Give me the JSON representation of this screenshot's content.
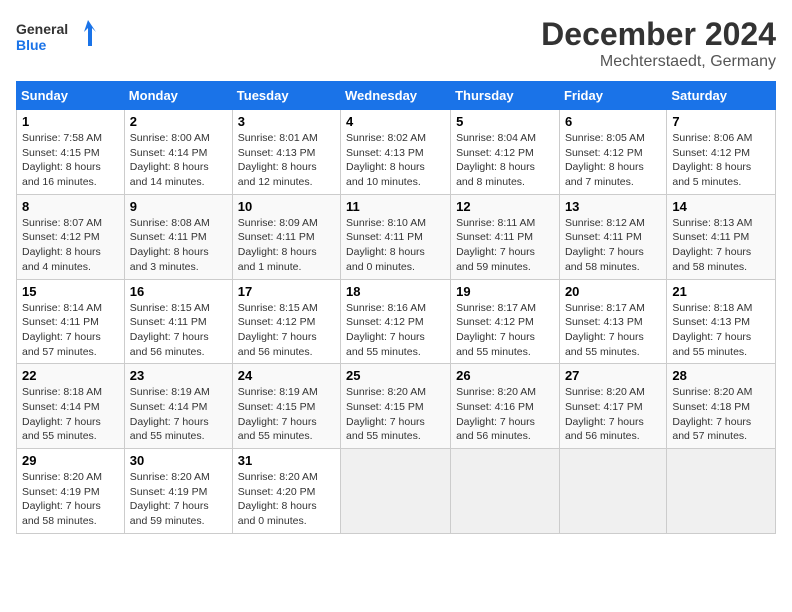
{
  "logo": {
    "general": "General",
    "blue": "Blue"
  },
  "title": "December 2024",
  "location": "Mechterstaedt, Germany",
  "days_of_week": [
    "Sunday",
    "Monday",
    "Tuesday",
    "Wednesday",
    "Thursday",
    "Friday",
    "Saturday"
  ],
  "weeks": [
    [
      {
        "day": "1",
        "sunrise": "Sunrise: 7:58 AM",
        "sunset": "Sunset: 4:15 PM",
        "daylight": "Daylight: 8 hours and 16 minutes."
      },
      {
        "day": "2",
        "sunrise": "Sunrise: 8:00 AM",
        "sunset": "Sunset: 4:14 PM",
        "daylight": "Daylight: 8 hours and 14 minutes."
      },
      {
        "day": "3",
        "sunrise": "Sunrise: 8:01 AM",
        "sunset": "Sunset: 4:13 PM",
        "daylight": "Daylight: 8 hours and 12 minutes."
      },
      {
        "day": "4",
        "sunrise": "Sunrise: 8:02 AM",
        "sunset": "Sunset: 4:13 PM",
        "daylight": "Daylight: 8 hours and 10 minutes."
      },
      {
        "day": "5",
        "sunrise": "Sunrise: 8:04 AM",
        "sunset": "Sunset: 4:12 PM",
        "daylight": "Daylight: 8 hours and 8 minutes."
      },
      {
        "day": "6",
        "sunrise": "Sunrise: 8:05 AM",
        "sunset": "Sunset: 4:12 PM",
        "daylight": "Daylight: 8 hours and 7 minutes."
      },
      {
        "day": "7",
        "sunrise": "Sunrise: 8:06 AM",
        "sunset": "Sunset: 4:12 PM",
        "daylight": "Daylight: 8 hours and 5 minutes."
      }
    ],
    [
      {
        "day": "8",
        "sunrise": "Sunrise: 8:07 AM",
        "sunset": "Sunset: 4:12 PM",
        "daylight": "Daylight: 8 hours and 4 minutes."
      },
      {
        "day": "9",
        "sunrise": "Sunrise: 8:08 AM",
        "sunset": "Sunset: 4:11 PM",
        "daylight": "Daylight: 8 hours and 3 minutes."
      },
      {
        "day": "10",
        "sunrise": "Sunrise: 8:09 AM",
        "sunset": "Sunset: 4:11 PM",
        "daylight": "Daylight: 8 hours and 1 minute."
      },
      {
        "day": "11",
        "sunrise": "Sunrise: 8:10 AM",
        "sunset": "Sunset: 4:11 PM",
        "daylight": "Daylight: 8 hours and 0 minutes."
      },
      {
        "day": "12",
        "sunrise": "Sunrise: 8:11 AM",
        "sunset": "Sunset: 4:11 PM",
        "daylight": "Daylight: 7 hours and 59 minutes."
      },
      {
        "day": "13",
        "sunrise": "Sunrise: 8:12 AM",
        "sunset": "Sunset: 4:11 PM",
        "daylight": "Daylight: 7 hours and 58 minutes."
      },
      {
        "day": "14",
        "sunrise": "Sunrise: 8:13 AM",
        "sunset": "Sunset: 4:11 PM",
        "daylight": "Daylight: 7 hours and 58 minutes."
      }
    ],
    [
      {
        "day": "15",
        "sunrise": "Sunrise: 8:14 AM",
        "sunset": "Sunset: 4:11 PM",
        "daylight": "Daylight: 7 hours and 57 minutes."
      },
      {
        "day": "16",
        "sunrise": "Sunrise: 8:15 AM",
        "sunset": "Sunset: 4:11 PM",
        "daylight": "Daylight: 7 hours and 56 minutes."
      },
      {
        "day": "17",
        "sunrise": "Sunrise: 8:15 AM",
        "sunset": "Sunset: 4:12 PM",
        "daylight": "Daylight: 7 hours and 56 minutes."
      },
      {
        "day": "18",
        "sunrise": "Sunrise: 8:16 AM",
        "sunset": "Sunset: 4:12 PM",
        "daylight": "Daylight: 7 hours and 55 minutes."
      },
      {
        "day": "19",
        "sunrise": "Sunrise: 8:17 AM",
        "sunset": "Sunset: 4:12 PM",
        "daylight": "Daylight: 7 hours and 55 minutes."
      },
      {
        "day": "20",
        "sunrise": "Sunrise: 8:17 AM",
        "sunset": "Sunset: 4:13 PM",
        "daylight": "Daylight: 7 hours and 55 minutes."
      },
      {
        "day": "21",
        "sunrise": "Sunrise: 8:18 AM",
        "sunset": "Sunset: 4:13 PM",
        "daylight": "Daylight: 7 hours and 55 minutes."
      }
    ],
    [
      {
        "day": "22",
        "sunrise": "Sunrise: 8:18 AM",
        "sunset": "Sunset: 4:14 PM",
        "daylight": "Daylight: 7 hours and 55 minutes."
      },
      {
        "day": "23",
        "sunrise": "Sunrise: 8:19 AM",
        "sunset": "Sunset: 4:14 PM",
        "daylight": "Daylight: 7 hours and 55 minutes."
      },
      {
        "day": "24",
        "sunrise": "Sunrise: 8:19 AM",
        "sunset": "Sunset: 4:15 PM",
        "daylight": "Daylight: 7 hours and 55 minutes."
      },
      {
        "day": "25",
        "sunrise": "Sunrise: 8:20 AM",
        "sunset": "Sunset: 4:15 PM",
        "daylight": "Daylight: 7 hours and 55 minutes."
      },
      {
        "day": "26",
        "sunrise": "Sunrise: 8:20 AM",
        "sunset": "Sunset: 4:16 PM",
        "daylight": "Daylight: 7 hours and 56 minutes."
      },
      {
        "day": "27",
        "sunrise": "Sunrise: 8:20 AM",
        "sunset": "Sunset: 4:17 PM",
        "daylight": "Daylight: 7 hours and 56 minutes."
      },
      {
        "day": "28",
        "sunrise": "Sunrise: 8:20 AM",
        "sunset": "Sunset: 4:18 PM",
        "daylight": "Daylight: 7 hours and 57 minutes."
      }
    ],
    [
      {
        "day": "29",
        "sunrise": "Sunrise: 8:20 AM",
        "sunset": "Sunset: 4:19 PM",
        "daylight": "Daylight: 7 hours and 58 minutes."
      },
      {
        "day": "30",
        "sunrise": "Sunrise: 8:20 AM",
        "sunset": "Sunset: 4:19 PM",
        "daylight": "Daylight: 7 hours and 59 minutes."
      },
      {
        "day": "31",
        "sunrise": "Sunrise: 8:20 AM",
        "sunset": "Sunset: 4:20 PM",
        "daylight": "Daylight: 8 hours and 0 minutes."
      },
      null,
      null,
      null,
      null
    ]
  ]
}
